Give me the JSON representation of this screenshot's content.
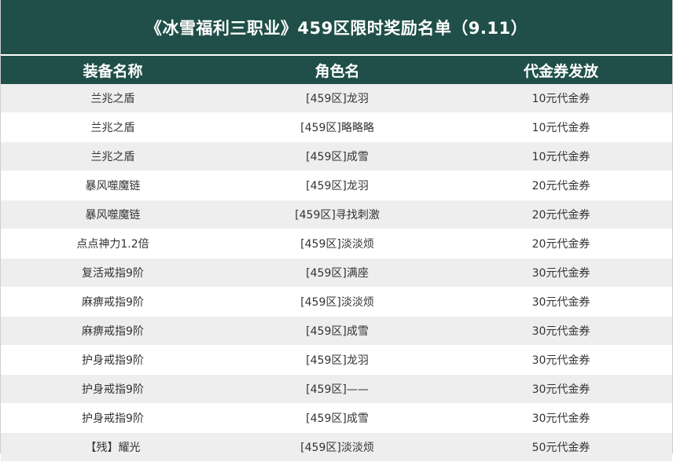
{
  "title": "《冰雪福利三职业》459区限时奖励名单（9.11）",
  "columns": [
    "装备名称",
    "角色名",
    "代金券发放"
  ],
  "rows": [
    [
      "兰兆之盾",
      "[459区]龙羽",
      "10元代金券"
    ],
    [
      "兰兆之盾",
      "[459区]略略略",
      "10元代金券"
    ],
    [
      "兰兆之盾",
      "[459区]成雪",
      "10元代金券"
    ],
    [
      "暴风噬魔链",
      "[459区]龙羽",
      "20元代金券"
    ],
    [
      "暴风噬魔链",
      "[459区]寻找刺激",
      "20元代金券"
    ],
    [
      "点点神力1.2倍",
      "[459区]淡淡烦",
      "20元代金券"
    ],
    [
      "复活戒指9阶",
      "[459区]满座",
      "30元代金券"
    ],
    [
      "麻痹戒指9阶",
      "[459区]淡淡烦",
      "30元代金券"
    ],
    [
      "麻痹戒指9阶",
      "[459区]成雪",
      "30元代金券"
    ],
    [
      "护身戒指9阶",
      "[459区]龙羽",
      "30元代金券"
    ],
    [
      "护身戒指9阶",
      "[459区]——",
      "30元代金券"
    ],
    [
      "护身戒指9阶",
      "[459区]成雪",
      "30元代金券"
    ],
    [
      "【残】耀光",
      "[459区]淡淡烦",
      "50元代金券"
    ]
  ],
  "colors": {
    "header_bg": "#1f4f48",
    "header_text": "#ffffff",
    "row_alt_bg": "#eeeeee",
    "row_bg": "#ffffff",
    "cell_text": "#333333"
  }
}
